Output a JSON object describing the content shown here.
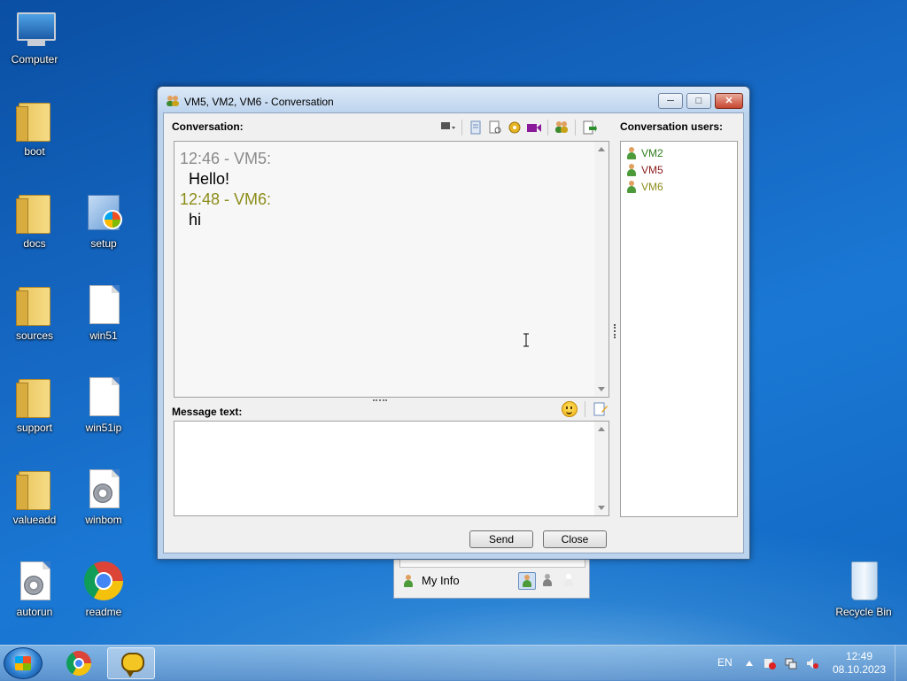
{
  "desktop": {
    "icons": [
      {
        "label": "Computer"
      },
      {
        "label": "boot"
      },
      {
        "label": "docs"
      },
      {
        "label": "setup"
      },
      {
        "label": "sources"
      },
      {
        "label": "win51"
      },
      {
        "label": "support"
      },
      {
        "label": "win51ip"
      },
      {
        "label": "valueadd"
      },
      {
        "label": "winbom"
      },
      {
        "label": "autorun"
      },
      {
        "label": "readme"
      },
      {
        "label": "Recycle Bin"
      }
    ]
  },
  "window": {
    "title": "VM5, VM2, VM6 - Conversation",
    "conversation_label": "Conversation:",
    "users_label": "Conversation users:",
    "message_label": "Message text:",
    "messages": [
      {
        "time_sender": "12:46 - VM5:",
        "text": "Hello!",
        "color": "#8a8a8a"
      },
      {
        "time_sender": "12:48 - VM6:",
        "text": "hi",
        "color": "#8c8c1a"
      }
    ],
    "users": [
      {
        "name": "VM2",
        "color": "#2e7d1a"
      },
      {
        "name": "VM5",
        "color": "#8b1a1a"
      },
      {
        "name": "VM6",
        "color": "#8c8c1a"
      }
    ],
    "message_value": "",
    "send_label": "Send",
    "close_label": "Close"
  },
  "contact_list": {
    "my_info_label": "My Info"
  },
  "taskbar": {
    "language": "EN",
    "time": "12:49",
    "date": "08.10.2023"
  }
}
